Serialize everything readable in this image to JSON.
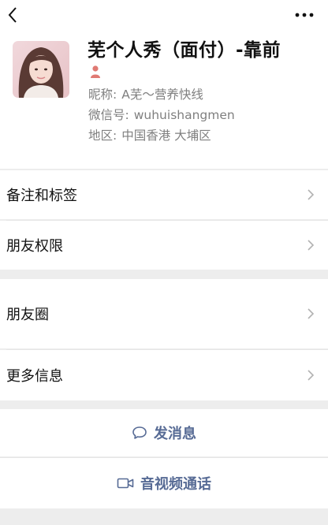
{
  "profile": {
    "display_name": "芜个人秀（面付）-靠前",
    "nickname_label": "昵称:",
    "nickname": "A芜～营养快线",
    "wechat_id_label": "微信号:",
    "wechat_id": "wuhuishangmen",
    "region_label": "地区:",
    "region": "中国香港 大埔区",
    "gender_icon": "female-icon"
  },
  "menu": {
    "remarks_tags": "备注和标签",
    "friend_permissions": "朋友权限",
    "moments": "朋友圈",
    "more_info": "更多信息"
  },
  "actions": {
    "send_message": "发消息",
    "video_call": "音视频通话"
  },
  "colors": {
    "accent": "#576b95",
    "background": "#ededed",
    "secondary_text": "#7f7f7f",
    "gender_female": "#e07a73"
  }
}
